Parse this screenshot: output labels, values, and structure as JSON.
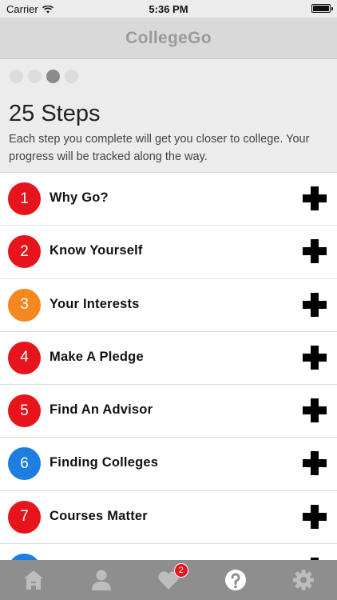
{
  "status_bar": {
    "carrier": "Carrier",
    "time": "5:36 PM"
  },
  "app": {
    "title": "CollegeGo"
  },
  "intro": {
    "page_dots": 4,
    "active_dot": 2,
    "title": "25 Steps",
    "description": "Each step you complete will get you closer to college. Your progress will be tracked along the way."
  },
  "steps": [
    {
      "number": "1",
      "label": "Why Go?",
      "color": "#e8141c"
    },
    {
      "number": "2",
      "label": "Know Yourself",
      "color": "#e8141c"
    },
    {
      "number": "3",
      "label": "Your Interests",
      "color": "#f5871f"
    },
    {
      "number": "4",
      "label": "Make A Pledge",
      "color": "#e8141c"
    },
    {
      "number": "5",
      "label": "Find An Advisor",
      "color": "#e8141c"
    },
    {
      "number": "6",
      "label": "Finding Colleges",
      "color": "#1d7de0"
    },
    {
      "number": "7",
      "label": "Courses Matter",
      "color": "#e8141c"
    },
    {
      "number": "",
      "label": "",
      "color": "#1d7de0"
    }
  ],
  "tab_bar": {
    "tabs": [
      {
        "name": "home",
        "icon": "home-icon"
      },
      {
        "name": "profile",
        "icon": "person-icon"
      },
      {
        "name": "favorites",
        "icon": "heart-icon",
        "badge": "2"
      },
      {
        "name": "help",
        "icon": "question-icon",
        "active": true
      },
      {
        "name": "settings",
        "icon": "gear-icon"
      }
    ]
  }
}
